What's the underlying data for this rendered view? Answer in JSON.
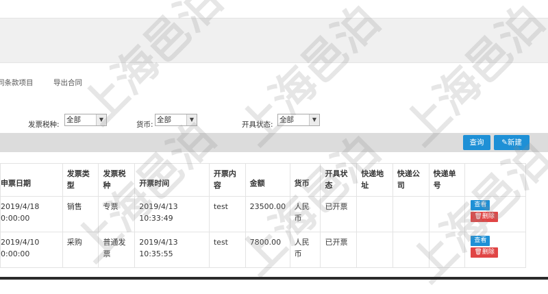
{
  "tabs": [
    "同条款项目",
    "导出合同"
  ],
  "filters": [
    {
      "label": "发票税种:",
      "value": "全部"
    },
    {
      "label": "货币:",
      "value": "全部"
    },
    {
      "label": "开具状态:",
      "value": "全部"
    }
  ],
  "toolbar": {
    "query_label": "查询",
    "new_label": "新建"
  },
  "table": {
    "headers": [
      "申票日期",
      "发票类型",
      "发票税种",
      "开票时间",
      "开票内容",
      "金额",
      "货币",
      "开具状态",
      "快递地址",
      "快递公司",
      "快递单号"
    ],
    "header_lines": [
      [
        "申票日期"
      ],
      [
        "发票类",
        "型"
      ],
      [
        "发票税",
        "种"
      ],
      [
        "开票时间"
      ],
      [
        "开票内",
        "容"
      ],
      [
        "金额"
      ],
      [
        "货币"
      ],
      [
        "开具状",
        "态"
      ],
      [
        "快递地",
        "址"
      ],
      [
        "快递公",
        "司"
      ],
      [
        "快递单",
        "号"
      ]
    ],
    "rows": [
      {
        "date_l1": "2019/4/18",
        "date_l2": "0:00:00",
        "type": "销售",
        "tax_l1": "专票",
        "tax_l2": "",
        "time_l1": "2019/4/13",
        "time_l2": "10:33:49",
        "content": "test",
        "amount": "23500.00",
        "cur_l1": "人民",
        "cur_l2": "币",
        "status": "已开票",
        "address": "",
        "company": "",
        "tracking": "",
        "view": "查看",
        "delete": "删除"
      },
      {
        "date_l1": "2019/4/10",
        "date_l2": "0:00:00",
        "type": "采购",
        "tax_l1": "普通发",
        "tax_l2": "票",
        "time_l1": "2019/4/13",
        "time_l2": "10:35:55",
        "content": "test",
        "amount": "7800.00",
        "cur_l1": "人民",
        "cur_l2": "币",
        "status": "已开票",
        "address": "",
        "company": "",
        "tracking": "",
        "view": "查看",
        "delete": "删除"
      }
    ]
  },
  "watermark": "上海邑泊",
  "colors": {
    "primary": "#1e90d6",
    "danger": "#e04545",
    "titlebar": "#f0f0f0",
    "toolbar": "#dcdcdc"
  }
}
